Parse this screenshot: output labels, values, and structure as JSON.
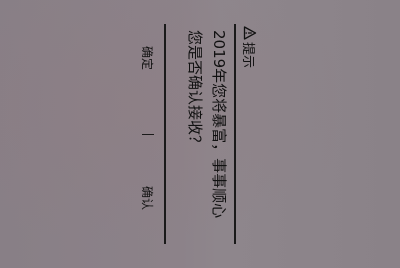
{
  "dialog": {
    "title": "提示",
    "title_icon": "warning-triangle-icon",
    "message_line1": "2019年您将暴富，事事顺心",
    "message_line2": "您是否确认接收？",
    "buttons": {
      "confirm_left": "确定",
      "confirm_right": "确认"
    }
  }
}
